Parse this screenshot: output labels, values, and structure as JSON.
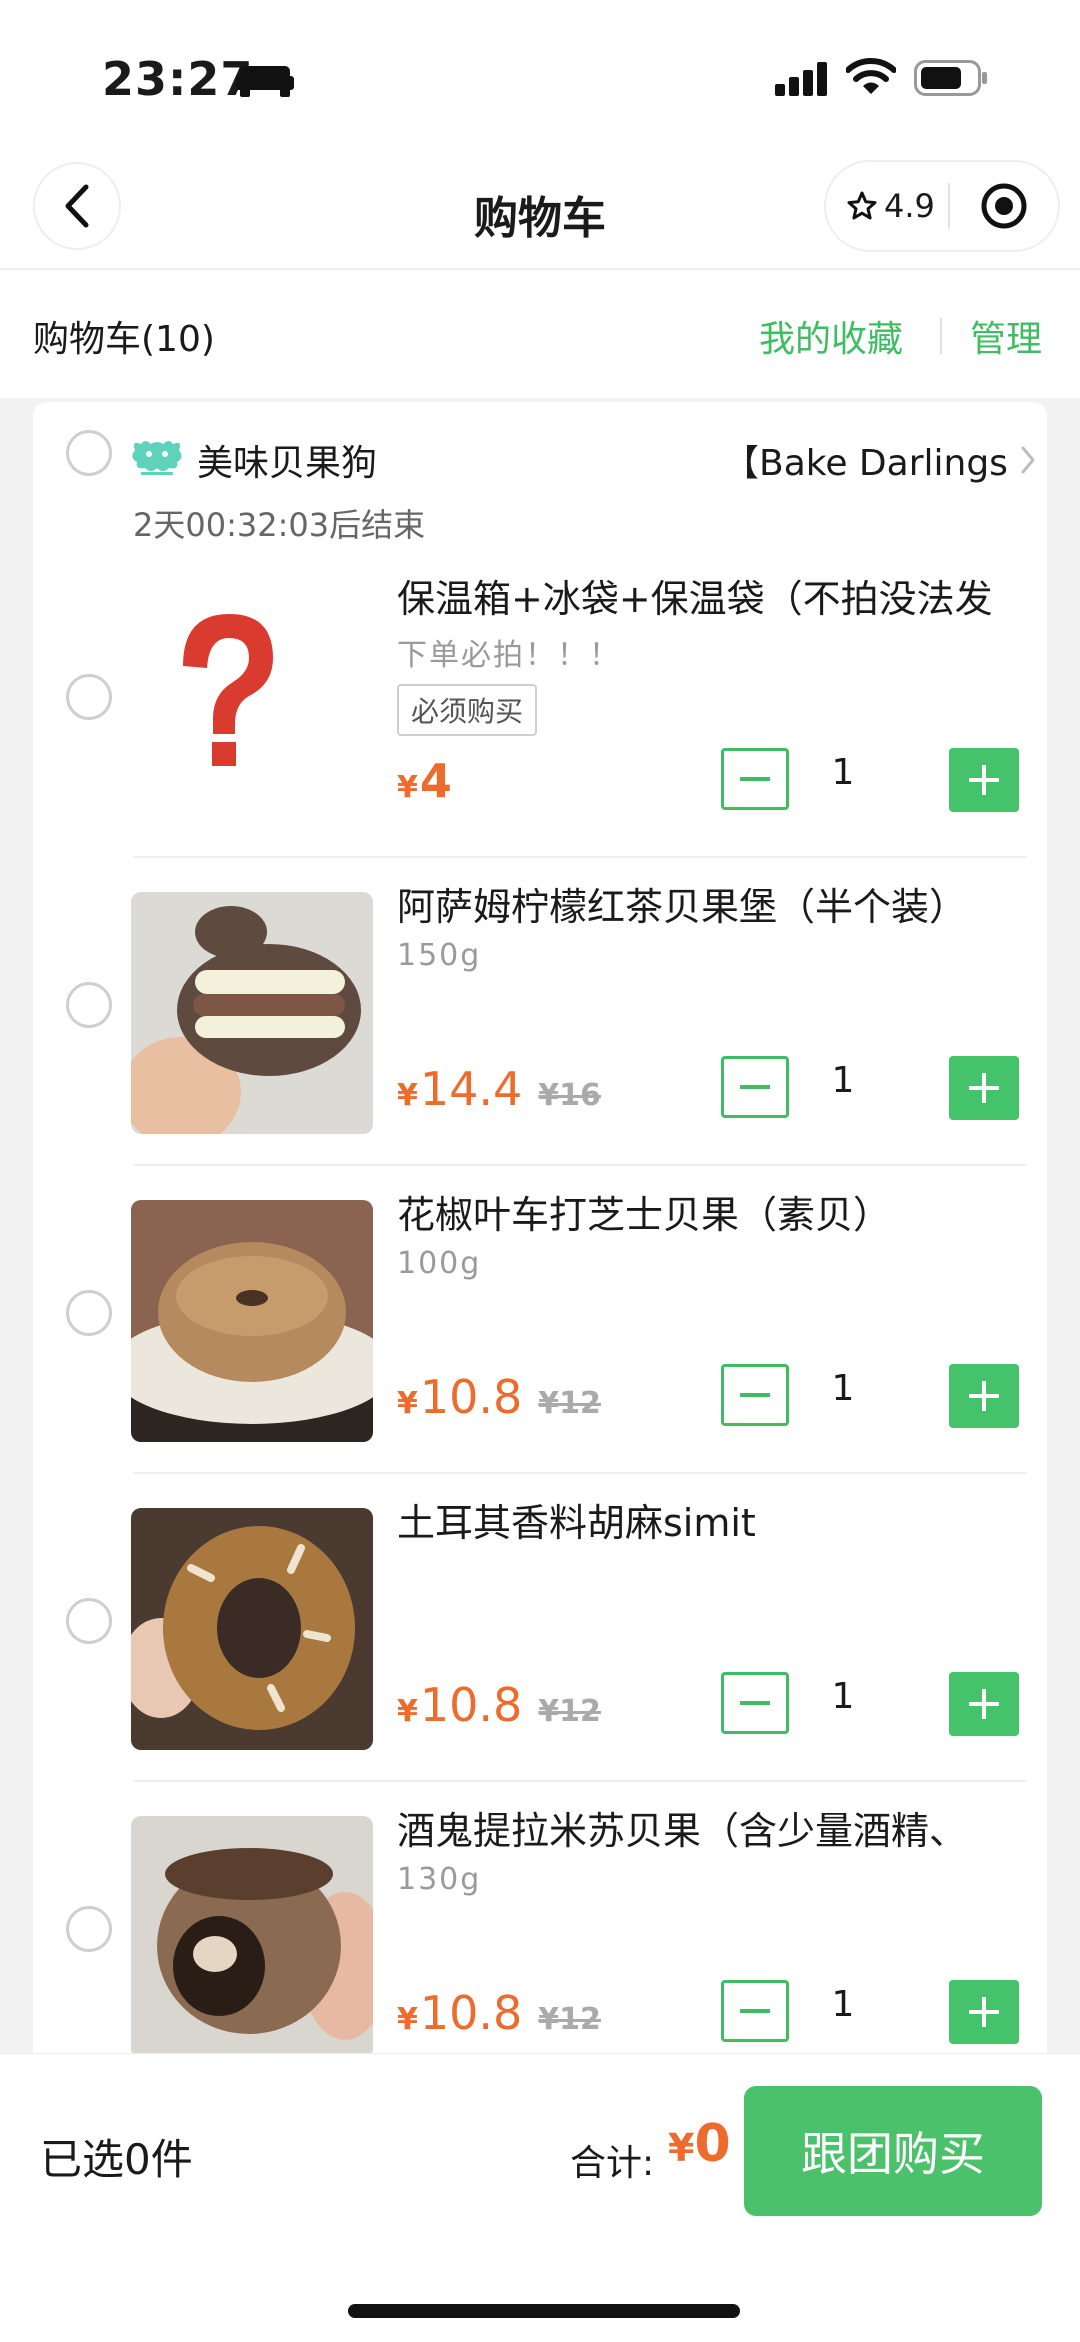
{
  "status_bar": {
    "time": "23:27"
  },
  "nav": {
    "title": "购物车",
    "rating": "4.9"
  },
  "cart_header": {
    "count_label": "购物车(10)",
    "favorites": "我的收藏",
    "manage": "管理"
  },
  "shop": {
    "name": "美味贝果狗",
    "link": "【Bake Darlings",
    "countdown": "2天00:32:03后结束"
  },
  "items": [
    {
      "title": "保温箱+冰袋+保温袋（不拍没法发",
      "subtitle": "下单必拍！！！",
      "tag": "必须购买",
      "yen": "¥",
      "price": "4",
      "original": "",
      "qty": "1"
    },
    {
      "title": "阿萨姆柠檬红茶贝果堡（半个装）",
      "subtitle": "150g",
      "yen": "¥",
      "price": "14.4",
      "original": "¥16",
      "qty": "1"
    },
    {
      "title": "花椒叶车打芝士贝果（素贝）",
      "subtitle": "100g",
      "yen": "¥",
      "price": "10.8",
      "original": "¥12",
      "qty": "1"
    },
    {
      "title": "土耳其香料胡麻simit",
      "subtitle": "",
      "yen": "¥",
      "price": "10.8",
      "original": "¥12",
      "qty": "1"
    },
    {
      "title": "酒鬼提拉米苏贝果（含少量酒精、",
      "subtitle": "130g",
      "yen": "¥",
      "price": "10.8",
      "original": "¥12",
      "qty": "1"
    }
  ],
  "bottom": {
    "selected": "已选0件",
    "total_label": "合计:",
    "yen": "¥",
    "total": "0",
    "buy": "跟团购买"
  },
  "colors": {
    "accent_green": "#3fbd63",
    "price_orange": "#ec6b2d"
  },
  "icons": [
    "back-arrow-icon",
    "star-icon",
    "target-icon",
    "chevron-right-icon",
    "question-mark-icon",
    "minus-icon",
    "plus-icon"
  ]
}
